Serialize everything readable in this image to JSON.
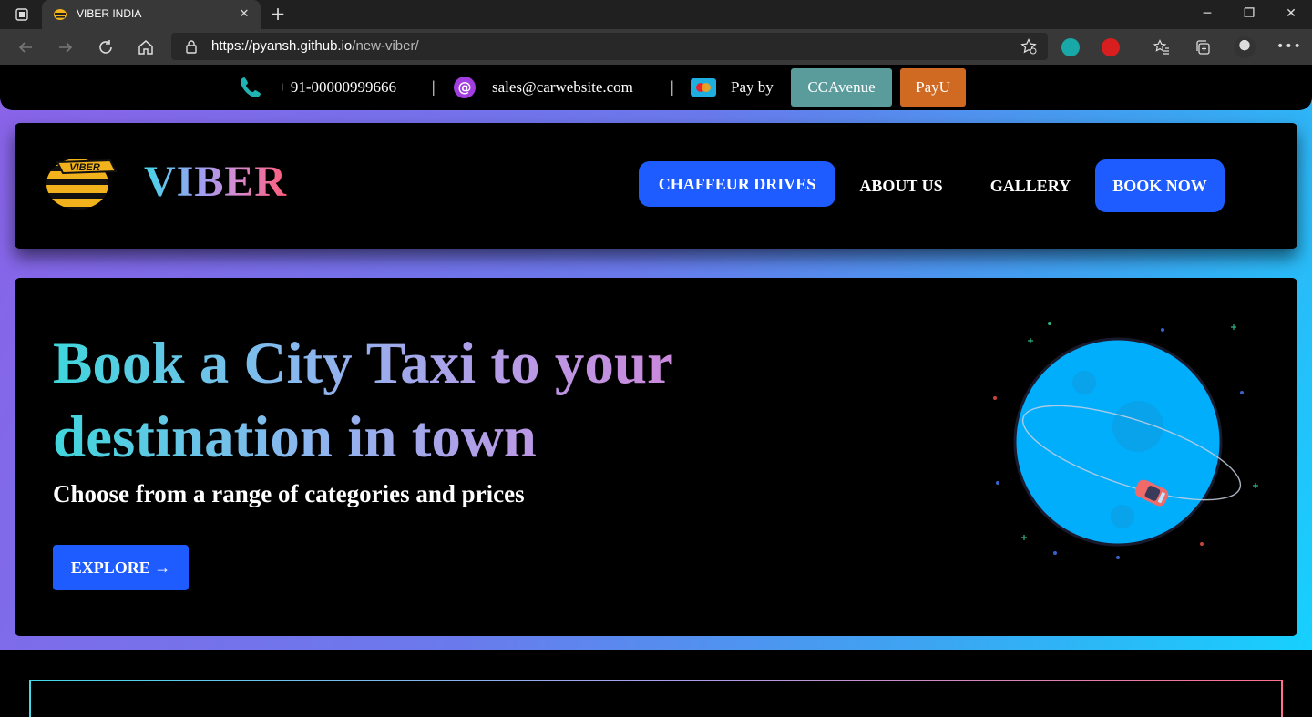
{
  "browser": {
    "tab_title": "VIBER INDIA",
    "url_host": "https://pyansh.github.io",
    "url_path": "/new-viber/",
    "icons": [
      "tab-actions-icon",
      "close-icon",
      "plus-icon",
      "minimize-icon",
      "maximize-icon",
      "window-close-icon",
      "back-icon",
      "forward-icon",
      "reload-icon",
      "home-icon",
      "lock-icon",
      "favorite-add-icon",
      "extension-icon",
      "favorites-icon",
      "collections-icon",
      "profile-avatar",
      "more-icon"
    ]
  },
  "topbar": {
    "phone": "+ 91-00000999666",
    "separator": "|",
    "email": "sales@carwebsite.com",
    "pay_label": "Pay by",
    "pay_options": [
      "CCAvenue",
      "PayU"
    ],
    "colors": {
      "ccavenue": "#5a9b9c",
      "payu": "#d06a22"
    }
  },
  "header": {
    "brand": "VIBER",
    "logo_text": "VIBER",
    "nav": [
      "CHAFFEUR DRIVES",
      "ABOUT US",
      "GALLERY",
      "BOOK NOW"
    ],
    "accent": "#1e5cff"
  },
  "hero": {
    "title": "Book a City Taxi to your destination in town",
    "subtitle": "Choose from a range of categories and prices",
    "cta": "EXPLORE →"
  }
}
